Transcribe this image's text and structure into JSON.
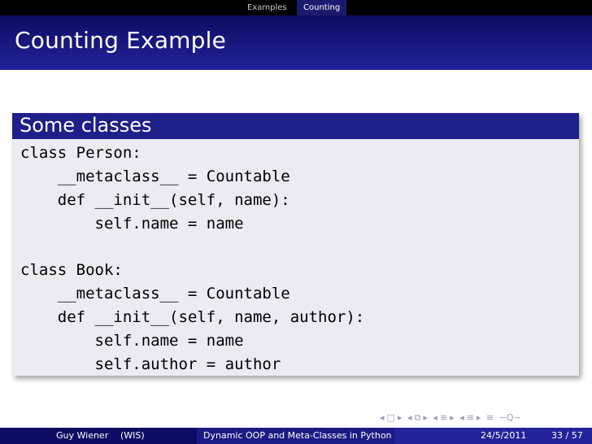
{
  "nav": {
    "tabs": [
      {
        "label": "Examples"
      },
      {
        "label": "Counting"
      }
    ]
  },
  "frame": {
    "title": "Counting Example"
  },
  "block": {
    "title": "Some classes",
    "code_lines": [
      "class Person:",
      "    __metaclass__ = Countable",
      "    def __init__(self, name):",
      "        self.name = name",
      "",
      "class Book:",
      "    __metaclass__ = Countable",
      "    def __init__(self, name, author):",
      "        self.name = name",
      "        self.author = author"
    ]
  },
  "footer": {
    "author": "Guy Wiener",
    "institute": "(WIS)",
    "title": "Dynamic OOP and Meta-Classes in Python",
    "date": "24/5/2011",
    "page": "33 / 57"
  },
  "nav_symbols": [
    {
      "icon": "arrow-left-icon"
    },
    {
      "icon": "frame-icon"
    },
    {
      "icon": "arrow-right-icon"
    },
    {
      "icon": "arrow-left-icon"
    },
    {
      "icon": "subsection-icon"
    },
    {
      "icon": "arrow-right-icon"
    },
    {
      "icon": "arrow-left-icon"
    },
    {
      "icon": "section-icon"
    },
    {
      "icon": "arrow-right-icon"
    },
    {
      "icon": "arrow-left-icon"
    },
    {
      "icon": "section-icon"
    },
    {
      "icon": "arrow-right-icon"
    },
    {
      "icon": "align-icon"
    },
    {
      "icon": "search-icon"
    }
  ]
}
